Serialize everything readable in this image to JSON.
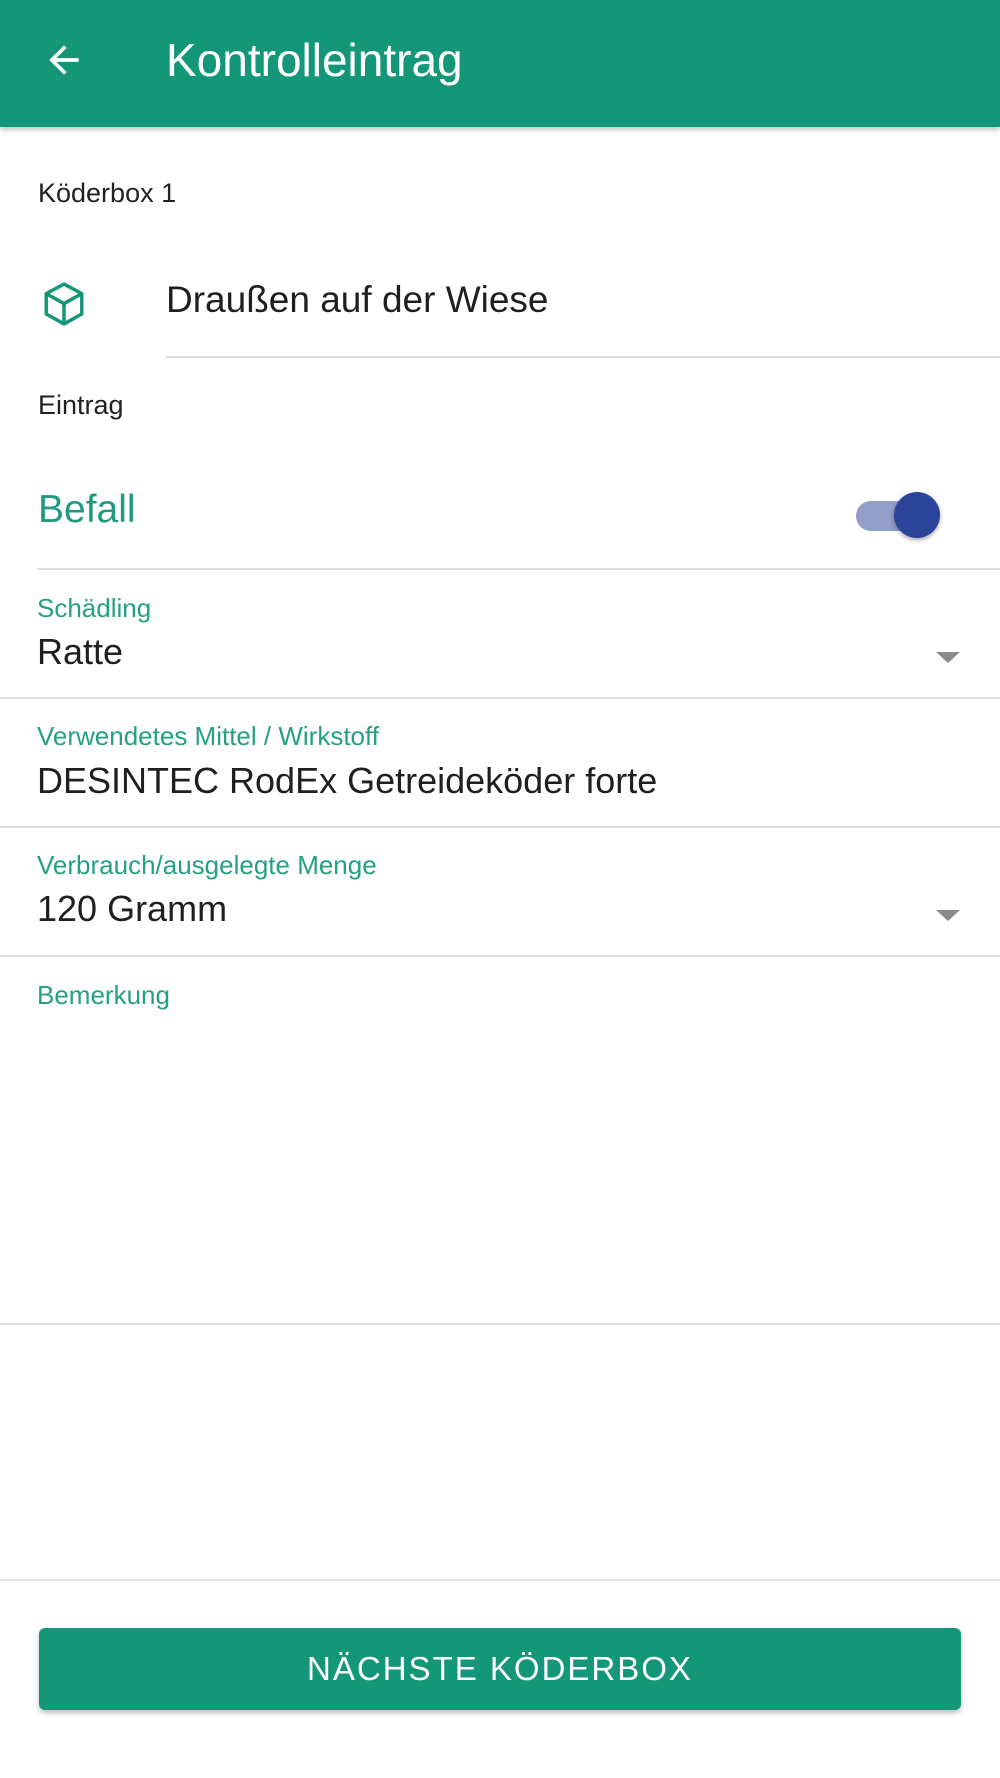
{
  "app_bar": {
    "title": "Kontrolleintrag",
    "back_icon": "arrow-left-icon",
    "color": "#149778"
  },
  "bait_box": {
    "label": "Köderbox 1",
    "location_icon": "cube-icon",
    "location": "Draußen auf der Wiese"
  },
  "entry": {
    "section_label": "Eintrag",
    "infestation": {
      "label": "Befall",
      "enabled": true
    }
  },
  "fields": {
    "pest": {
      "label": "Schädling",
      "value": "Ratte"
    },
    "agent": {
      "label": "Verwendetes Mittel / Wirkstoff",
      "value": "DESINTEC RodEx Getreideköder forte"
    },
    "amount": {
      "label": "Verbrauch/ausgelegte Menge",
      "value": "120 Gramm"
    },
    "remark": {
      "label": "Bemerkung",
      "value": ""
    }
  },
  "actions": {
    "next_label": "NÄCHSTE KÖDERBOX"
  },
  "colors": {
    "primary": "#149778",
    "accent_text": "#26a084",
    "toggle_thumb": "#2b4399",
    "toggle_track": "#939ec9"
  }
}
